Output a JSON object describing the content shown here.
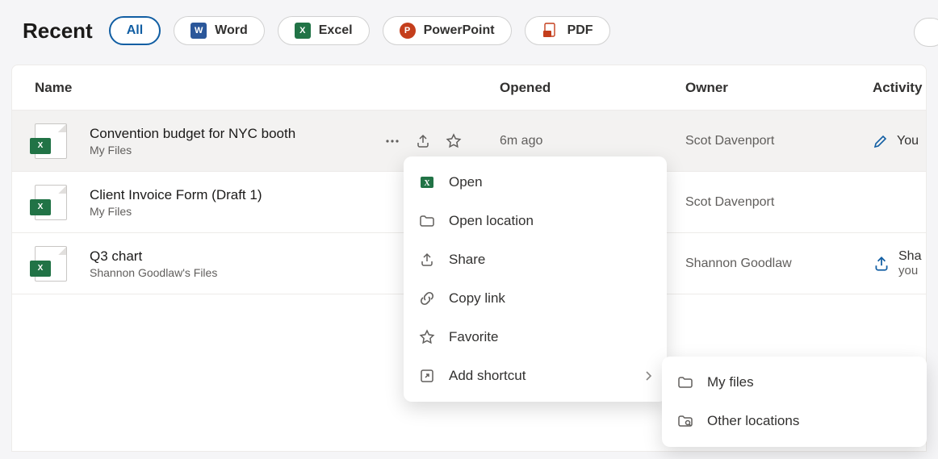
{
  "header": {
    "title": "Recent",
    "filters": [
      "All",
      "Word",
      "Excel",
      "PowerPoint",
      "PDF"
    ]
  },
  "columns": {
    "name": "Name",
    "opened": "Opened",
    "owner": "Owner",
    "activity": "Activity"
  },
  "files": [
    {
      "title": "Convention budget for NYC booth",
      "location": "My Files",
      "opened": "6m ago",
      "owner": "Scot Davenport",
      "activity_text": "You",
      "activity_kind": "edit"
    },
    {
      "title": "Client Invoice Form (Draft 1)",
      "location": "My Files",
      "opened": "",
      "owner": "Scot Davenport",
      "activity_text": "",
      "activity_kind": ""
    },
    {
      "title": "Q3 chart",
      "location": "Shannon Goodlaw's Files",
      "opened": "",
      "owner": "Shannon Goodlaw",
      "activity_line1": "Sha",
      "activity_line2": "you",
      "activity_kind": "share"
    }
  ],
  "context_menu": {
    "open": "Open",
    "open_location": "Open location",
    "share": "Share",
    "copy_link": "Copy link",
    "favorite": "Favorite",
    "add_shortcut": "Add shortcut"
  },
  "sub_menu": {
    "my_files": "My files",
    "other_locations": "Other locations"
  }
}
